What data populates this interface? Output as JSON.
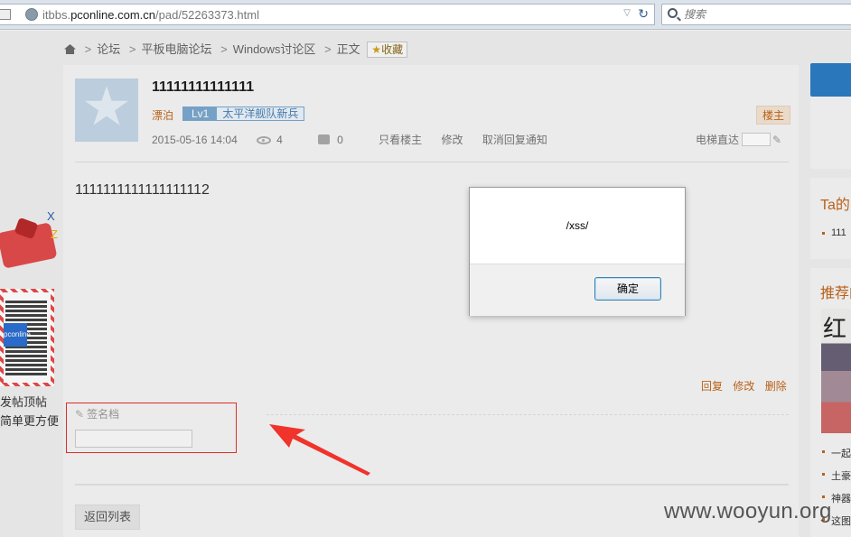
{
  "browser": {
    "url_prefix": "itbbs.",
    "url_domain": "pconline.com.cn",
    "url_path": "/pad/52263373.html",
    "search_placeholder": "搜索"
  },
  "breadcrumb": {
    "items": [
      "论坛",
      "平板电脑论坛",
      "Windows讨论区",
      "正文"
    ],
    "favorite": "收藏"
  },
  "post": {
    "title": "11111111111111",
    "author": "漂泊",
    "level": "Lv1",
    "rank": "太平洋舰队新兵",
    "owner_badge": "楼主",
    "date": "2015-05-16 14:04",
    "views": "4",
    "replies": "0",
    "only_owner": "只看楼主",
    "edit": "修改",
    "cancel_notify": "取消回复通知",
    "elevator": "电梯直达",
    "content": "1111111111111111112",
    "actions": [
      "回复",
      "修改",
      "删除"
    ],
    "signature_label": "签名档",
    "back_button": "返回列表"
  },
  "promo": {
    "line1": "发帖顶帖",
    "line2": "简单更方便",
    "logo": "pconline"
  },
  "sidebar": {
    "ta_heading": "Ta的",
    "ta_item": "111",
    "rec_heading": "推荐的",
    "rec_items": [
      "一起",
      "土豪",
      "神器",
      "这图"
    ]
  },
  "dialog": {
    "message": "/xss/",
    "ok_label": "确定"
  },
  "watermark": "www.wooyun.org"
}
